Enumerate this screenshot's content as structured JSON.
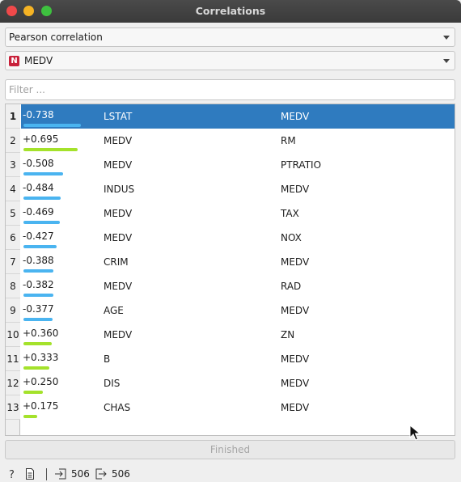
{
  "window": {
    "title": "Correlations"
  },
  "correlation_type": {
    "selected": "Pearson correlation"
  },
  "feature": {
    "badge": "N",
    "selected": "MEDV"
  },
  "filter": {
    "placeholder": "Filter ...",
    "value": ""
  },
  "rows": [
    {
      "n": "1",
      "value": "-0.738",
      "a": "LSTAT",
      "b": "MEDV",
      "strength": 0.738,
      "sign": "neg",
      "selected": true
    },
    {
      "n": "2",
      "value": "+0.695",
      "a": "MEDV",
      "b": "RM",
      "strength": 0.695,
      "sign": "pos"
    },
    {
      "n": "3",
      "value": "-0.508",
      "a": "MEDV",
      "b": "PTRATIO",
      "strength": 0.508,
      "sign": "neg"
    },
    {
      "n": "4",
      "value": "-0.484",
      "a": "INDUS",
      "b": "MEDV",
      "strength": 0.484,
      "sign": "neg"
    },
    {
      "n": "5",
      "value": "-0.469",
      "a": "MEDV",
      "b": "TAX",
      "strength": 0.469,
      "sign": "neg"
    },
    {
      "n": "6",
      "value": "-0.427",
      "a": "MEDV",
      "b": "NOX",
      "strength": 0.427,
      "sign": "neg"
    },
    {
      "n": "7",
      "value": "-0.388",
      "a": "CRIM",
      "b": "MEDV",
      "strength": 0.388,
      "sign": "neg"
    },
    {
      "n": "8",
      "value": "-0.382",
      "a": "MEDV",
      "b": "RAD",
      "strength": 0.382,
      "sign": "neg"
    },
    {
      "n": "9",
      "value": "-0.377",
      "a": "AGE",
      "b": "MEDV",
      "strength": 0.377,
      "sign": "neg"
    },
    {
      "n": "10",
      "value": "+0.360",
      "a": "MEDV",
      "b": "ZN",
      "strength": 0.36,
      "sign": "pos"
    },
    {
      "n": "11",
      "value": "+0.333",
      "a": "B",
      "b": "MEDV",
      "strength": 0.333,
      "sign": "pos"
    },
    {
      "n": "12",
      "value": "+0.250",
      "a": "DIS",
      "b": "MEDV",
      "strength": 0.25,
      "sign": "pos"
    },
    {
      "n": "13",
      "value": "+0.175",
      "a": "CHAS",
      "b": "MEDV",
      "strength": 0.175,
      "sign": "pos"
    }
  ],
  "colors": {
    "negative": "#4ab4f0",
    "positive": "#a4e22b",
    "selection": "#2f7bbf"
  },
  "finished_button": {
    "label": "Finished"
  },
  "status": {
    "input_count": "506",
    "output_count": "506"
  },
  "icons": [
    "help-icon",
    "report-icon",
    "input-icon",
    "output-icon"
  ]
}
